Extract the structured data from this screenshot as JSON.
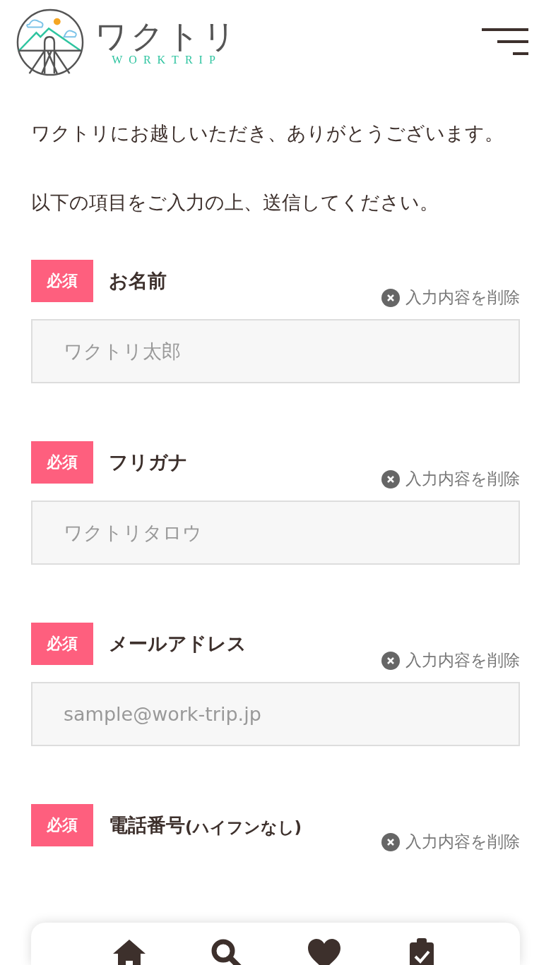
{
  "header": {
    "logo_text": "ワクトリ",
    "logo_subtext": "WORKTRIP"
  },
  "intro": [
    "ワクトリにお越しいただき、ありがとうございます。",
    "以下の項目をご入力の上、送信してください。"
  ],
  "fields": [
    {
      "badge": "必須",
      "label": "お名前",
      "clear": "入力内容を削除",
      "placeholder": "ワクトリ太郎"
    },
    {
      "badge": "必須",
      "label": "フリガナ",
      "clear": "入力内容を削除",
      "placeholder": "ワクトリタロウ"
    },
    {
      "badge": "必須",
      "label": "メールアドレス",
      "clear": "入力内容を削除",
      "placeholder": "sample@work-trip.jp"
    },
    {
      "badge": "必須",
      "label": "電話番号",
      "label_note": "(ハイフンなし)",
      "clear": "入力内容を削除"
    }
  ],
  "bottom_nav": [
    {
      "kind": "home"
    },
    {
      "kind": "search"
    },
    {
      "kind": "heart"
    },
    {
      "kind": "clipboard"
    }
  ]
}
